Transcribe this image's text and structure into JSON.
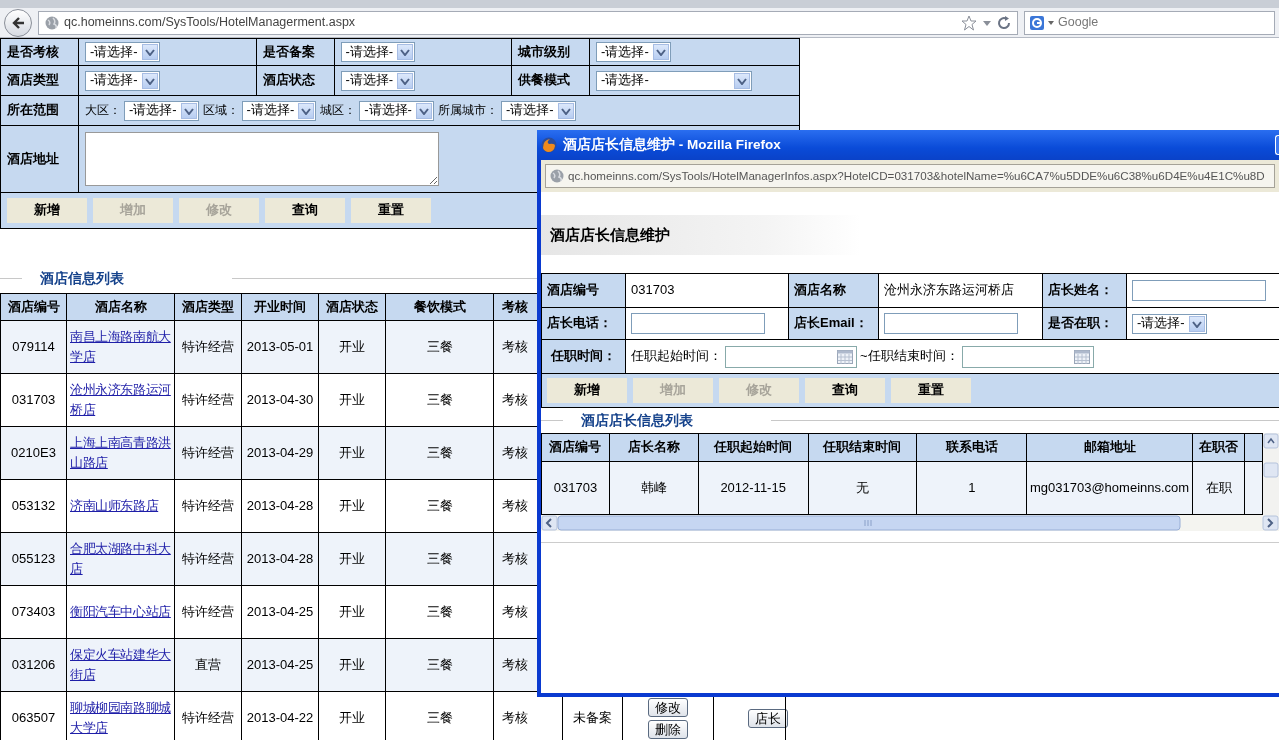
{
  "browser": {
    "url": "qc.homeinns.com/SysTools/HotelManagerment.aspx",
    "search_placeholder": "Google"
  },
  "filter_form": {
    "rows": [
      {
        "kind": "selects",
        "fields": [
          {
            "label": "是否考核",
            "value": "-请选择-"
          },
          {
            "label": "是否备案",
            "value": "-请选择-"
          },
          {
            "label": "城市级别",
            "value": "-请选择-"
          }
        ]
      },
      {
        "kind": "selects",
        "fields": [
          {
            "label": "酒店类型",
            "value": "-请选择-"
          },
          {
            "label": "酒店状态",
            "value": "-请选择-"
          },
          {
            "label": "供餐模式",
            "value": "-请选择-"
          }
        ]
      },
      {
        "kind": "range",
        "label": "所在范围",
        "parts": [
          {
            "label": "大区：",
            "value": "-请选择-"
          },
          {
            "label": "区域：",
            "value": "-请选择-"
          },
          {
            "label": "城区：",
            "value": "-请选择-"
          },
          {
            "label": "所属城市：",
            "value": "-请选择-"
          }
        ]
      },
      {
        "kind": "textarea",
        "label": "酒店地址"
      }
    ],
    "buttons": [
      {
        "label": "新增",
        "disabled": false
      },
      {
        "label": "增加",
        "disabled": true
      },
      {
        "label": "修改",
        "disabled": true
      },
      {
        "label": "查询",
        "disabled": false
      },
      {
        "label": "重置",
        "disabled": false
      }
    ]
  },
  "hotel_list": {
    "title": "酒店信息列表",
    "columns": [
      "酒店编号",
      "酒店名称",
      "酒店类型",
      "开业时间",
      "酒店状态",
      "餐饮模式",
      "考核"
    ],
    "rows": [
      {
        "cells": [
          "079114",
          "南昌上海路南航大学店",
          "特许经营",
          "2013-05-01",
          "开业",
          "三餐",
          "考核"
        ]
      },
      {
        "cells": [
          "031703",
          "沧州永济东路运河桥店",
          "特许经营",
          "2013-04-30",
          "开业",
          "三餐",
          "考核"
        ]
      },
      {
        "cells": [
          "0210E3",
          "上海上南高青路洪山路店",
          "特许经营",
          "2013-04-29",
          "开业",
          "三餐",
          "考核"
        ]
      },
      {
        "cells": [
          "053132",
          "济南山师东路店",
          "特许经营",
          "2013-04-28",
          "开业",
          "三餐",
          "考核"
        ]
      },
      {
        "cells": [
          "055123",
          "合肥太湖路中科大店",
          "特许经营",
          "2013-04-28",
          "开业",
          "三餐",
          "考核"
        ]
      },
      {
        "cells": [
          "073403",
          "衡阳汽车中心站店",
          "特许经营",
          "2013-04-25",
          "开业",
          "三餐",
          "考核"
        ]
      },
      {
        "cells": [
          "031206",
          "保定火车站建华大街店",
          "直营",
          "2013-04-25",
          "开业",
          "三餐",
          "考核"
        ]
      },
      {
        "cells": [
          "063507",
          "聊城柳园南路聊城大学店",
          "特许经营",
          "2013-04-22",
          "开业",
          "三餐",
          "考核"
        ],
        "filing": "未备案",
        "actions": [
          "修改",
          "删除"
        ],
        "manager_button": "店长"
      }
    ]
  },
  "popup": {
    "title": "酒店店长信息维护 - Mozilla Firefox",
    "url": "qc.homeinns.com/SysTools/HotelManagerInfos.aspx?HotelCD=031703&hotelName=%u6CA7%u5DDE%u6C38%u6D4E%u4E1C%u8D",
    "heading": "酒店店长信息维护",
    "form_rows": [
      [
        {
          "label": "酒店编号",
          "kind": "text",
          "value": "031703"
        },
        {
          "label": "酒店名称",
          "kind": "text",
          "value": "沧州永济东路运河桥店"
        },
        {
          "label": "店长姓名：",
          "kind": "input"
        }
      ],
      [
        {
          "label": "店长电话：",
          "kind": "input"
        },
        {
          "label": "店长Email：",
          "kind": "input"
        },
        {
          "label": "是否在职：",
          "kind": "select",
          "value": "-请选择-"
        }
      ]
    ],
    "period": {
      "label": "任职时间：",
      "start_label": "任职起始时间：",
      "end_label": "~任职结束时间："
    },
    "buttons": [
      {
        "label": "新增",
        "disabled": false
      },
      {
        "label": "增加",
        "disabled": true
      },
      {
        "label": "修改",
        "disabled": true
      },
      {
        "label": "查询",
        "disabled": false
      },
      {
        "label": "重置",
        "disabled": false
      }
    ],
    "list_title": "酒店店长信息列表",
    "columns": [
      "酒店编号",
      "店长名称",
      "任职起始时间",
      "任职结束时间",
      "联系电话",
      "邮箱地址",
      "在职否"
    ],
    "rows": [
      [
        "031703",
        "韩峰",
        "2012-11-15",
        "无",
        "1",
        "mg031703@homeinns.com",
        "在职"
      ]
    ]
  }
}
